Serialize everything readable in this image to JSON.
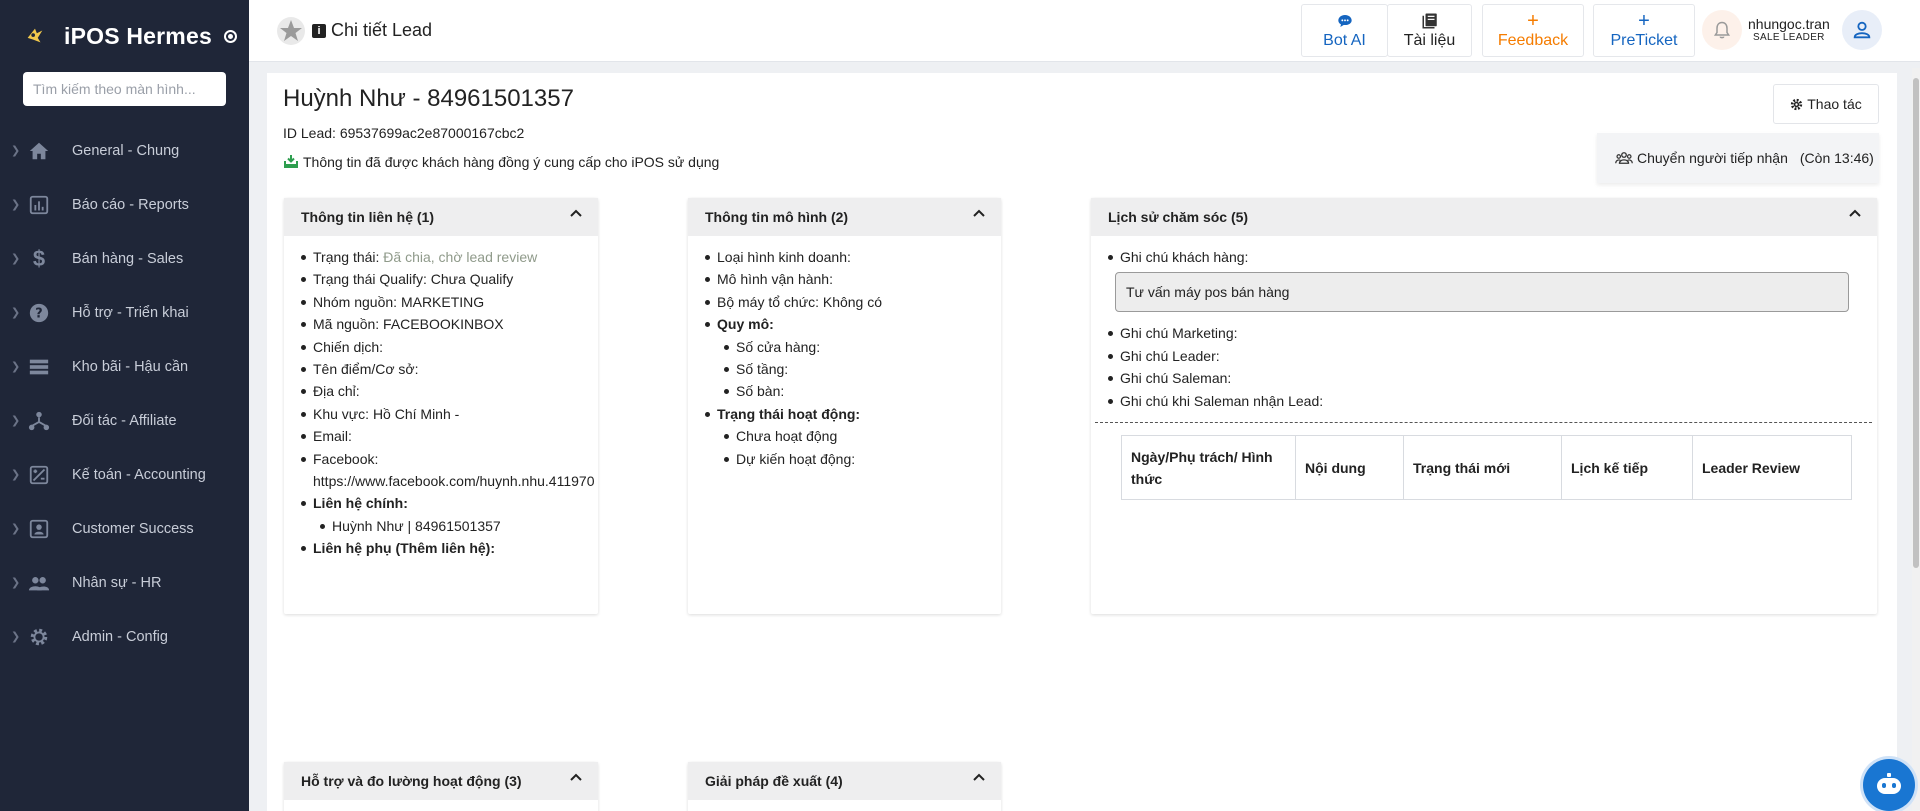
{
  "sidebar": {
    "brand": "iPOS Hermes",
    "search_placeholder": "Tìm kiếm theo màn hình...",
    "items": [
      {
        "label": "General - Chung",
        "icon": "home-icon"
      },
      {
        "label": "Báo cáo - Reports",
        "icon": "bar-chart-icon"
      },
      {
        "label": "Bán hàng - Sales",
        "icon": "dollar-icon"
      },
      {
        "label": "Hỗ trợ - Triển khai",
        "icon": "help-circle-icon"
      },
      {
        "label": "Kho bãi - Hậu cần",
        "icon": "storage-icon"
      },
      {
        "label": "Đối tác - Affiliate",
        "icon": "network-icon"
      },
      {
        "label": "Kế toán - Accounting",
        "icon": "accounting-icon"
      },
      {
        "label": "Customer Success",
        "icon": "contact-card-icon"
      },
      {
        "label": "Nhân sự - HR",
        "icon": "people-icon"
      },
      {
        "label": "Admin - Config",
        "icon": "gear-icon"
      }
    ]
  },
  "header": {
    "title": "Chi tiết Lead",
    "buttons": {
      "bot_ai": "Bot AI",
      "tai_lieu": "Tài liệu",
      "feedback": "Feedback",
      "preticket": "PreTicket"
    },
    "user": {
      "name": "nhungoc.tran",
      "role": "SALE LEADER"
    },
    "colors": {
      "bot_ai": "#1565c0",
      "feedback": "#f57c00",
      "preticket": "#1565c0"
    }
  },
  "lead": {
    "title": "Huỳnh Như - 84961501357",
    "id_line": "ID Lead: 69537699ac2e87000167cbc2",
    "consent": "Thông tin đã được khách hàng đồng ý cung cấp cho iPOS sử dụng",
    "action_label": "Thao tác",
    "dropdown_label": "Chuyển người tiếp nhận",
    "dropdown_countdown": "(Còn 13:46)"
  },
  "panels": {
    "contact": {
      "title": "Thông tin liên hệ (1)",
      "status_label": "Trạng thái: ",
      "status_value": "Đã chia, chờ lead review",
      "qualify": "Trạng thái Qualify: Chưa Qualify",
      "source_group": "Nhóm nguồn: MARKETING",
      "source_code": "Mã nguồn: FACEBOOKINBOX",
      "campaign": "Chiến dịch:",
      "shop_name": "Tên điểm/Cơ sở:",
      "address": "Địa chỉ:",
      "region": "Khu vực: Hồ Chí Minh -",
      "email": "Email:",
      "facebook_label": "Facebook:",
      "facebook_url": "https://www.facebook.com/huynh.nhu.411970",
      "main_contact_label": "Liên hệ chính:",
      "main_contact": "Huỳnh Như | 84961501357",
      "extra_contact_label": "Liên hệ phụ (Thêm liên hệ):"
    },
    "model": {
      "title": "Thông tin mô hình (2)",
      "business_type": "Loại hình kinh doanh:",
      "operation_model": "Mô hình vận hành:",
      "org": "Bộ máy tổ chức: Không có",
      "scale_label": "Quy mô:",
      "stores": "Số cửa hàng:",
      "floors": "Số tầng:",
      "tables": "Số bàn:",
      "activity_label": "Trạng thái hoạt động:",
      "not_active": "Chưa hoạt động",
      "planned": "Dự kiến hoạt động:"
    },
    "history": {
      "title": "Lịch sử chăm sóc (5)",
      "customer_note_label": "Ghi chú khách hàng:",
      "customer_note": "Tư vấn máy pos bán hàng",
      "marketing_note": "Ghi chú Marketing:",
      "leader_note": "Ghi chú Leader:",
      "saleman_note": "Ghi chú Saleman:",
      "saleman_receive_note": "Ghi chú khi Saleman nhận Lead:",
      "table_headers": [
        "Ngày/Phụ trách/ Hình thức",
        "Nội dung",
        "Trạng thái mới",
        "Lịch kế tiếp",
        "Leader Review"
      ]
    },
    "support": {
      "title": "Hỗ trợ và đo lường hoạt động (3)"
    },
    "solution": {
      "title": "Giải pháp đề xuất (4)"
    }
  }
}
